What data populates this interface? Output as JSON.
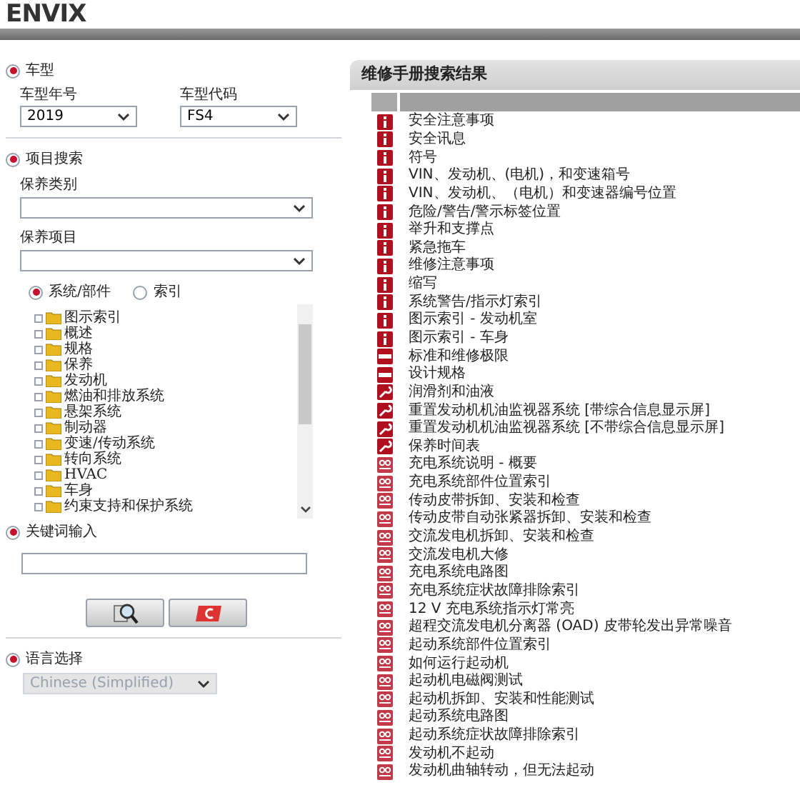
{
  "header": {
    "logo": "ENVIX"
  },
  "left": {
    "vehicle": {
      "title": "车型",
      "selected": true,
      "year_label": "车型年号",
      "year": "2019",
      "code_label": "车型代码",
      "code": "FS4"
    },
    "item_search": {
      "title": "项目搜索",
      "selected": true,
      "category_label": "保养类别",
      "item_label": "保养项目",
      "modes": [
        {
          "label": "系统/部件",
          "selected": true
        },
        {
          "label": "索引",
          "selected": false
        }
      ],
      "tree": [
        {
          "label": "图示索引"
        },
        {
          "label": "概述"
        },
        {
          "label": "规格"
        },
        {
          "label": "保养"
        },
        {
          "label": "发动机"
        },
        {
          "label": "燃油和排放系统"
        },
        {
          "label": "悬架系统"
        },
        {
          "label": "制动器"
        },
        {
          "label": "变速/传动系统"
        },
        {
          "label": "转向系统"
        },
        {
          "label": "HVAC"
        },
        {
          "label": "车身"
        },
        {
          "label": "约束支持和保护系统"
        }
      ]
    },
    "keyword": {
      "title": "关键词输入",
      "selected": true
    },
    "language": {
      "title": "语言选择",
      "selected": true,
      "value": "Chinese (Simplified)",
      "disabled": true
    }
  },
  "results": {
    "title": "维修手册搜索结果",
    "rows": [
      {
        "kind": "info",
        "text": "安全注意事项"
      },
      {
        "kind": "info",
        "text": "安全讯息"
      },
      {
        "kind": "info",
        "text": "符号"
      },
      {
        "kind": "info",
        "text": "VIN、发动机、(电机)，和变速箱号"
      },
      {
        "kind": "info",
        "text": "VIN、发动机、（电机）和变速器编号位置"
      },
      {
        "kind": "info",
        "text": "危险/警告/警示标签位置"
      },
      {
        "kind": "info",
        "text": "举升和支撑点"
      },
      {
        "kind": "info",
        "text": "紧急拖车"
      },
      {
        "kind": "info",
        "text": "维修注意事项"
      },
      {
        "kind": "info",
        "text": "缩写"
      },
      {
        "kind": "info",
        "text": "系统警告/指示灯索引"
      },
      {
        "kind": "info",
        "text": "图示索引 - 发动机室"
      },
      {
        "kind": "info",
        "text": "图示索引 - 车身"
      },
      {
        "kind": "spec",
        "text": "标准和维修极限"
      },
      {
        "kind": "spec",
        "text": "设计规格"
      },
      {
        "kind": "maintenance",
        "text": "润滑剂和油液"
      },
      {
        "kind": "maintenance",
        "text": "重置发动机机油监视器系统 [带综合信息显示屏]"
      },
      {
        "kind": "maintenance",
        "text": "重置发动机机油监视器系统 [不带综合信息显示屏]"
      },
      {
        "kind": "maintenance",
        "text": "保养时间表"
      },
      {
        "kind": "electrical",
        "text": "充电系统说明 - 概要"
      },
      {
        "kind": "electrical",
        "text": "充电系统部件位置索引"
      },
      {
        "kind": "electrical",
        "text": "传动皮带拆卸、安装和检查"
      },
      {
        "kind": "electrical",
        "text": "传动皮带自动张紧器拆卸、安装和检查"
      },
      {
        "kind": "electrical",
        "text": "交流发电机拆卸、安装和检查"
      },
      {
        "kind": "electrical",
        "text": "交流发电机大修"
      },
      {
        "kind": "electrical",
        "text": "充电系统电路图"
      },
      {
        "kind": "electrical",
        "text": "充电系统症状故障排除索引"
      },
      {
        "kind": "electrical",
        "text": "12 V 充电系统指示灯常亮"
      },
      {
        "kind": "electrical",
        "text": "超程交流发电机分离器 (OAD) 皮带轮发出异常噪音"
      },
      {
        "kind": "electrical",
        "text": "起动系统部件位置索引"
      },
      {
        "kind": "electrical",
        "text": "如何运行起动机"
      },
      {
        "kind": "electrical",
        "text": "起动机电磁阀测试"
      },
      {
        "kind": "electrical",
        "text": "起动机拆卸、安装和性能测试"
      },
      {
        "kind": "electrical",
        "text": "起动系统电路图"
      },
      {
        "kind": "electrical",
        "text": "起动系统症状故障排除索引"
      },
      {
        "kind": "electrical",
        "text": "发动机不起动"
      },
      {
        "kind": "electrical",
        "text": "发动机曲轴转动，但无法起动"
      }
    ]
  }
}
